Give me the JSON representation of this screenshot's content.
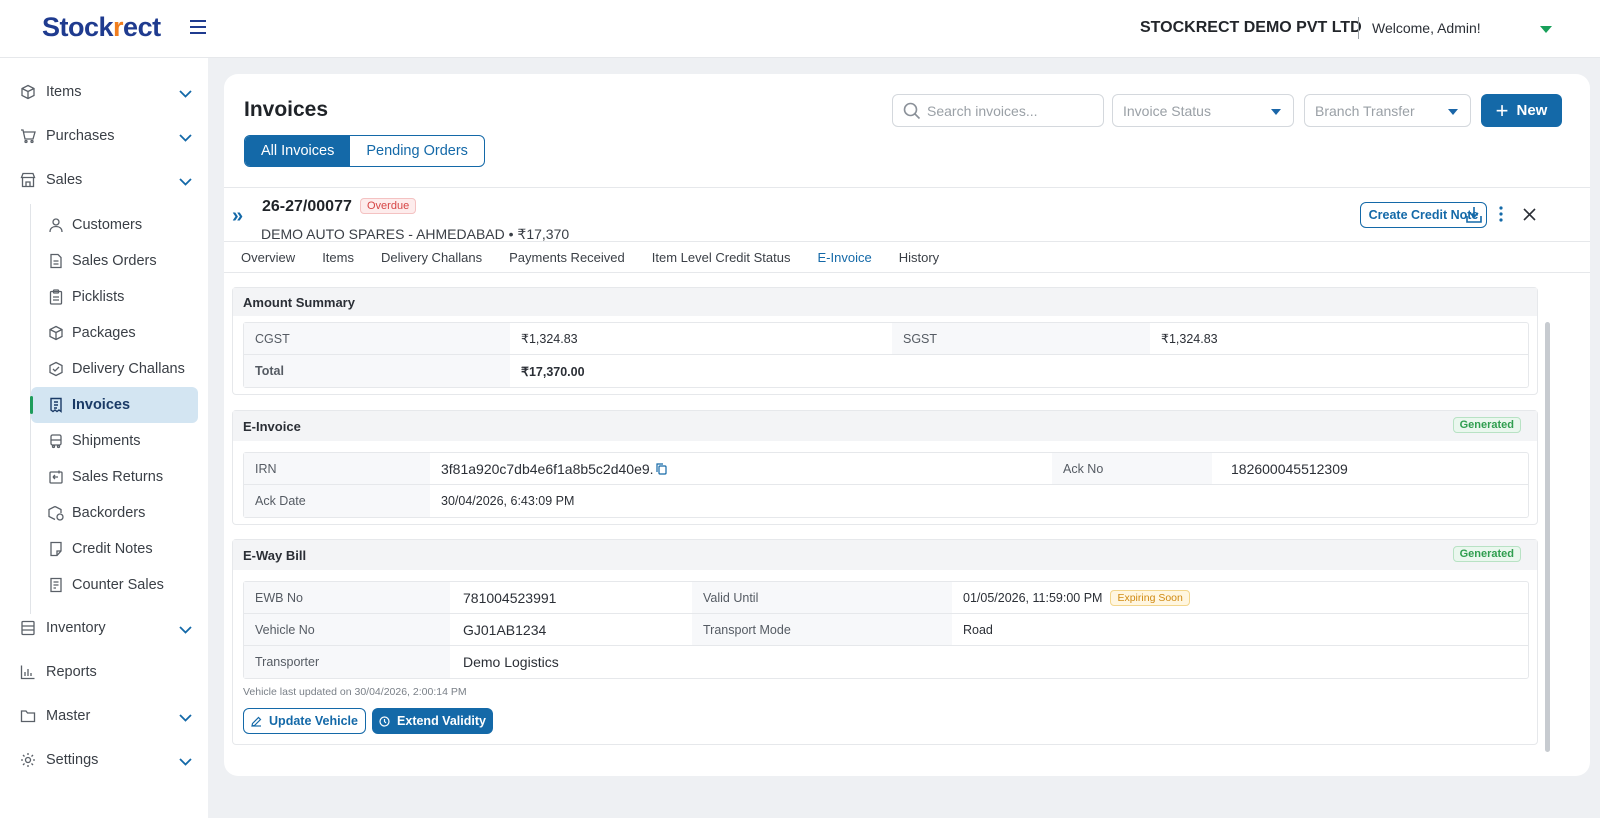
{
  "app": {
    "logo_main": "Stock",
    "logo_accent": "r",
    "logo_rest": "ect",
    "company": "STOCKRECT DEMO PVT LTD",
    "welcome": "Welcome, Admin!"
  },
  "sidebar": {
    "items": [
      {
        "label": "Items",
        "icon": "box-icon",
        "expandable": true
      },
      {
        "label": "Purchases",
        "icon": "cart-icon",
        "expandable": true
      },
      {
        "label": "Sales",
        "icon": "store-icon",
        "expandable": true
      },
      {
        "label": "Inventory",
        "icon": "inventory-icon",
        "expandable": true
      },
      {
        "label": "Reports",
        "icon": "chart-icon",
        "expandable": false
      },
      {
        "label": "Master",
        "icon": "folder-icon",
        "expandable": true
      },
      {
        "label": "Settings",
        "icon": "gear-icon",
        "expandable": true
      }
    ],
    "sales_sub": [
      {
        "label": "Customers",
        "icon": "users-icon"
      },
      {
        "label": "Sales Orders",
        "icon": "document-icon"
      },
      {
        "label": "Picklists",
        "icon": "clipboard-icon"
      },
      {
        "label": "Packages",
        "icon": "package-icon"
      },
      {
        "label": "Delivery Challans",
        "icon": "package-check-icon"
      },
      {
        "label": "Invoices",
        "icon": "invoice-icon",
        "active": true
      },
      {
        "label": "Shipments",
        "icon": "truck-icon"
      },
      {
        "label": "Sales Returns",
        "icon": "return-icon"
      },
      {
        "label": "Backorders",
        "icon": "backorder-icon"
      },
      {
        "label": "Credit Notes",
        "icon": "credit-note-icon"
      },
      {
        "label": "Counter Sales",
        "icon": "receipt-icon"
      }
    ]
  },
  "header": {
    "title": "Invoices",
    "search_placeholder": "Search invoices...",
    "status_placeholder": "Invoice Status",
    "branch_placeholder": "Branch Transfer",
    "new_label": "New",
    "seg_all": "All Invoices",
    "seg_pending": "Pending Orders"
  },
  "invoice": {
    "number": "26-27/00077",
    "status": "Overdue",
    "subtitle": "DEMO AUTO SPARES - AHMEDABAD • ₹17,370",
    "create_credit_note": "Create Credit Note",
    "tabs": [
      "Overview",
      "Items",
      "Delivery Challans",
      "Payments Received",
      "Item Level Credit Status",
      "E-Invoice",
      "History"
    ],
    "active_tab": "E-Invoice"
  },
  "amount_summary": {
    "title": "Amount Summary",
    "cgst_label": "CGST",
    "cgst": "₹1,324.83",
    "sgst_label": "SGST",
    "sgst": "₹1,324.83",
    "total_label": "Total",
    "total": "₹17,370.00"
  },
  "einvoice": {
    "title": "E-Invoice",
    "badge": "Generated",
    "irn_label": "IRN",
    "irn": "3f81a920c7db4e6f1a8b5c2d40e9.",
    "ack_no_label": "Ack No",
    "ack_no": "182600045512309",
    "ack_date_label": "Ack Date",
    "ack_date": "30/04/2026, 6:43:09 PM"
  },
  "eway": {
    "title": "E-Way Bill",
    "badge": "Generated",
    "ewb_no_label": "EWB No",
    "ewb_no": "781004523991",
    "valid_until_label": "Valid Until",
    "valid_until": "01/05/2026, 11:59:00 PM",
    "expiring": "Expiring Soon",
    "vehicle_label": "Vehicle No",
    "vehicle": "GJ01AB1234",
    "mode_label": "Transport Mode",
    "mode": "Road",
    "transporter_label": "Transporter",
    "transporter": "Demo Logistics",
    "note": "Vehicle last updated on 30/04/2026, 2:00:14 PM",
    "update_vehicle": "Update Vehicle",
    "extend_validity": "Extend Validity"
  },
  "colors": {
    "primary": "#1469a8",
    "success": "#2f9e4f",
    "danger": "#d64545",
    "warning": "#d08a12",
    "brand": "#1f3b8f",
    "brand_accent": "#f07d1e"
  }
}
